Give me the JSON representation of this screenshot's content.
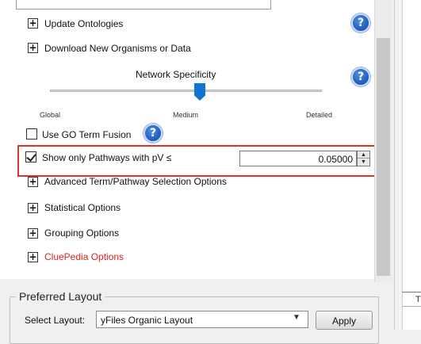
{
  "options": {
    "update_ontologies": "Update Ontologies",
    "download_organisms": "Download New Organisms or Data"
  },
  "network_specificity": {
    "title": "Network Specificity",
    "ticks": [
      "Global",
      "Medium",
      "Detailed"
    ],
    "level_percent": 50
  },
  "go_fusion": {
    "label": "Use GO Term Fusion",
    "checked": false
  },
  "pathway_filter": {
    "label": "Show only Pathways with pV ≤",
    "checked": true,
    "value": "0.05000"
  },
  "sections": {
    "advanced": "Advanced Term/Pathway Selection Options",
    "statistical": "Statistical Options",
    "grouping": "Grouping Options",
    "cluepedia": "CluePedia Options"
  },
  "colors": {
    "cluepedia": "#e02020",
    "highlight": "#e03030",
    "slider_thumb": "#1173d4",
    "help_icon": "#1f5fbf"
  },
  "help_symbol": "?",
  "expander_symbol": "+",
  "layout": {
    "group_title": "Preferred Layout",
    "select_label": "Select Layout:",
    "selected_value": "yFiles Organic Layout",
    "apply_label": "Apply"
  },
  "right_panel": {
    "header_fragment": "T"
  },
  "icons": [
    "expand-icon",
    "help-icon",
    "checkbox-icon",
    "chevron-down-icon",
    "spin-up-icon",
    "spin-down-icon"
  ]
}
